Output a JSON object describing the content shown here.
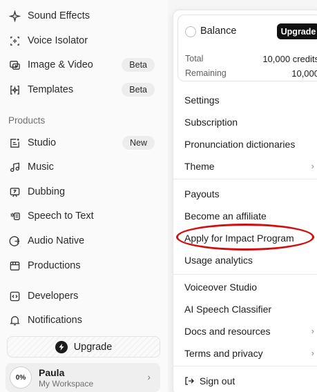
{
  "sidebar": {
    "items_top": [
      {
        "label": "Sound Effects",
        "icon": "sparkle-icon"
      },
      {
        "label": "Voice Isolator",
        "icon": "voice-isolator-icon"
      },
      {
        "label": "Image & Video",
        "icon": "image-video-icon",
        "badge": "Beta"
      },
      {
        "label": "Templates",
        "icon": "templates-icon",
        "badge": "Beta"
      }
    ],
    "section_label": "Products",
    "items_products": [
      {
        "label": "Studio",
        "icon": "studio-icon",
        "badge": "New"
      },
      {
        "label": "Music",
        "icon": "music-icon"
      },
      {
        "label": "Dubbing",
        "icon": "dubbing-icon"
      },
      {
        "label": "Speech to Text",
        "icon": "speech-to-text-icon"
      },
      {
        "label": "Audio Native",
        "icon": "audio-native-icon"
      },
      {
        "label": "Productions",
        "icon": "productions-icon"
      }
    ],
    "items_bottom": [
      {
        "label": "Developers",
        "icon": "code-icon"
      },
      {
        "label": "Notifications",
        "icon": "bell-icon"
      }
    ],
    "upgrade_label": "Upgrade",
    "user": {
      "percent": "0%",
      "name": "Paula",
      "workspace": "My Workspace"
    }
  },
  "menu": {
    "balance": {
      "title": "Balance",
      "upgrade_label": "Upgrade",
      "total_label": "Total",
      "total_value": "10,000 credits",
      "remaining_label": "Remaining",
      "remaining_value": "10,000"
    },
    "group1": [
      "Settings",
      "Subscription",
      "Pronunciation dictionaries",
      "Theme"
    ],
    "group2": [
      "Payouts",
      "Become an affiliate",
      "Apply for Impact Program",
      "Usage analytics"
    ],
    "group3": [
      "Voiceover Studio",
      "AI Speech Classifier",
      "Docs and resources",
      "Terms and privacy"
    ],
    "sign_out": "Sign out"
  },
  "colors": {
    "highlight": "#d01010",
    "accent": "#111111"
  }
}
